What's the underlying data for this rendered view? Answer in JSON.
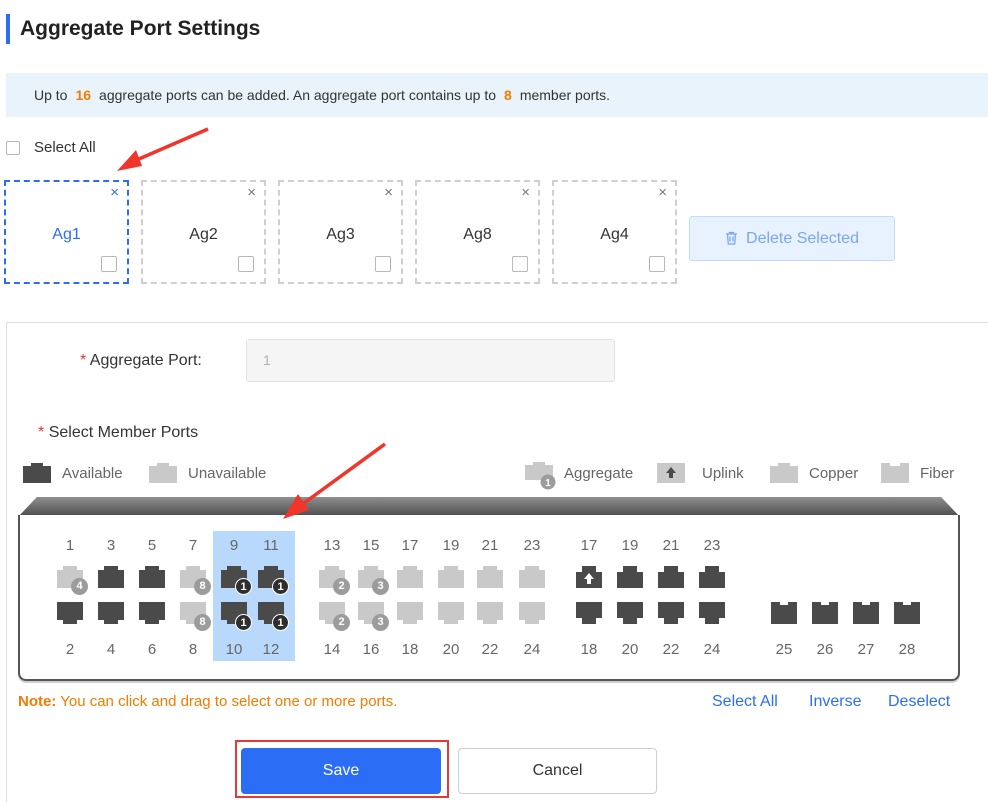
{
  "header": {
    "title": "Aggregate Port Settings"
  },
  "banner": {
    "text_1": "Up to",
    "max_aggregates": "16",
    "text_2": "aggregate ports can be added. An aggregate port contains up to",
    "max_members": "8",
    "text_3": "member ports."
  },
  "select_all": {
    "label": "Select All"
  },
  "ag_cards": [
    {
      "label": "Ag1",
      "active": true
    },
    {
      "label": "Ag2",
      "active": false
    },
    {
      "label": "Ag3",
      "active": false
    },
    {
      "label": "Ag8",
      "active": false
    },
    {
      "label": "Ag4",
      "active": false
    }
  ],
  "close_glyph": "×",
  "delete_selected": {
    "label": "Delete Selected",
    "icon": "trash-icon"
  },
  "form": {
    "required_mark": "*",
    "aggregate_port_label": "Aggregate Port:",
    "aggregate_port_value": "1",
    "member_ports_label": "Select Member Ports"
  },
  "legend": {
    "available": "Available",
    "unavailable": "Unavailable",
    "aggregate": "Aggregate",
    "aggregate_badge": "1",
    "uplink": "Uplink",
    "copper": "Copper",
    "fiber": "Fiber"
  },
  "ports": {
    "top_numbers": [
      "1",
      "3",
      "5",
      "7",
      "9",
      "11",
      "13",
      "15",
      "17",
      "19",
      "21",
      "23",
      "17",
      "19",
      "21",
      "23"
    ],
    "bottom_numbers": [
      "2",
      "4",
      "6",
      "8",
      "10",
      "12",
      "14",
      "16",
      "18",
      "20",
      "22",
      "24",
      "18",
      "20",
      "22",
      "24",
      "25",
      "26",
      "27",
      "28"
    ],
    "top_row": [
      {
        "state": "light",
        "badge": "4"
      },
      {
        "state": "dark"
      },
      {
        "state": "dark"
      },
      {
        "state": "light",
        "badge": "8"
      },
      {
        "state": "dark",
        "badge": "1",
        "badge_style": "dark"
      },
      {
        "state": "dark",
        "badge": "1",
        "badge_style": "dark"
      },
      {
        "state": "light",
        "badge": "2"
      },
      {
        "state": "light",
        "badge": "3"
      },
      {
        "state": "light"
      },
      {
        "state": "light"
      },
      {
        "state": "light"
      },
      {
        "state": "light"
      },
      {
        "state": "dark",
        "kind": "uplink"
      },
      {
        "state": "dark",
        "kind": "copper"
      },
      {
        "state": "dark",
        "kind": "copper"
      },
      {
        "state": "dark",
        "kind": "copper"
      }
    ],
    "bottom_row": [
      {
        "state": "dark"
      },
      {
        "state": "dark"
      },
      {
        "state": "dark"
      },
      {
        "state": "light",
        "badge": "8"
      },
      {
        "state": "dark",
        "badge": "1",
        "badge_style": "dark"
      },
      {
        "state": "dark",
        "badge": "1",
        "badge_style": "dark"
      },
      {
        "state": "light",
        "badge": "2"
      },
      {
        "state": "light",
        "badge": "3"
      },
      {
        "state": "light"
      },
      {
        "state": "light"
      },
      {
        "state": "light"
      },
      {
        "state": "light"
      },
      {
        "state": "dark",
        "kind": "copper"
      },
      {
        "state": "dark",
        "kind": "copper"
      },
      {
        "state": "dark",
        "kind": "copper"
      },
      {
        "state": "dark",
        "kind": "copper"
      },
      {
        "state": "dark",
        "kind": "fiber"
      },
      {
        "state": "dark",
        "kind": "fiber"
      },
      {
        "state": "dark",
        "kind": "fiber"
      },
      {
        "state": "dark",
        "kind": "fiber"
      }
    ],
    "selected": [
      "9",
      "10",
      "11",
      "12"
    ]
  },
  "note": {
    "prefix": "Note:",
    "text": "You can click and drag to select one or more ports."
  },
  "links": {
    "select_all": "Select All",
    "inverse": "Inverse",
    "deselect": "Deselect"
  },
  "buttons": {
    "save": "Save",
    "cancel": "Cancel"
  },
  "colors": {
    "accent": "#2b6ef5",
    "warning": "#f57a00",
    "danger": "#e53935",
    "port_dark": "#4a4a4a",
    "port_light": "#c9c9c9",
    "selection": "#b8d9fb"
  }
}
